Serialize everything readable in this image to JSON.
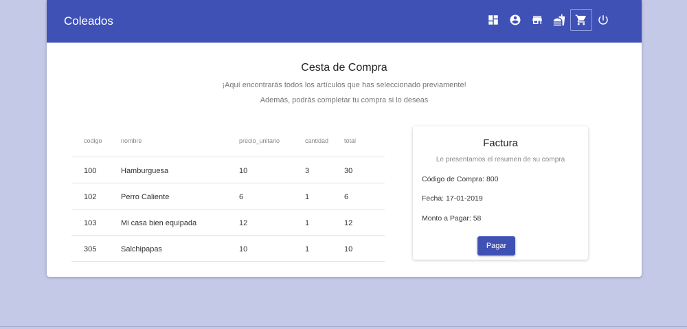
{
  "app": {
    "brand": "Coleados"
  },
  "toolbar": {
    "icons": [
      "dashboard-icon",
      "account-icon",
      "store-icon",
      "fastfood-icon",
      "cart-icon",
      "power-icon"
    ],
    "active": "cart-icon"
  },
  "page": {
    "title": "Cesta de Compra",
    "subtitle1": "¡Aquí encontrarás todos los artículos que has seleccionado previamente!",
    "subtitle2": "Además, podrás completar tu compra si lo deseas"
  },
  "table": {
    "columns": [
      "codigo",
      "nombre",
      "precio_unitario",
      "cantidad",
      "total"
    ],
    "rows": [
      [
        "100",
        "Hamburguesa",
        "10",
        "3",
        "30"
      ],
      [
        "102",
        "Perro Caliente",
        "6",
        "1",
        "6"
      ],
      [
        "103",
        "Mi casa bien equipada",
        "12",
        "1",
        "12"
      ],
      [
        "305",
        "Salchipapas",
        "10",
        "1",
        "10"
      ]
    ]
  },
  "invoice": {
    "title": "Factura",
    "subtitle": "Le presentamos el resumen de su compra",
    "code_line": "Código de Compra: 800",
    "date_line": "Fecha: 17-01-2019",
    "amount_line": "Monto a Pagar: 58",
    "pay_label": "Pagar"
  },
  "colors": {
    "primary": "#3f51b5",
    "background": "#c5c9e8"
  }
}
